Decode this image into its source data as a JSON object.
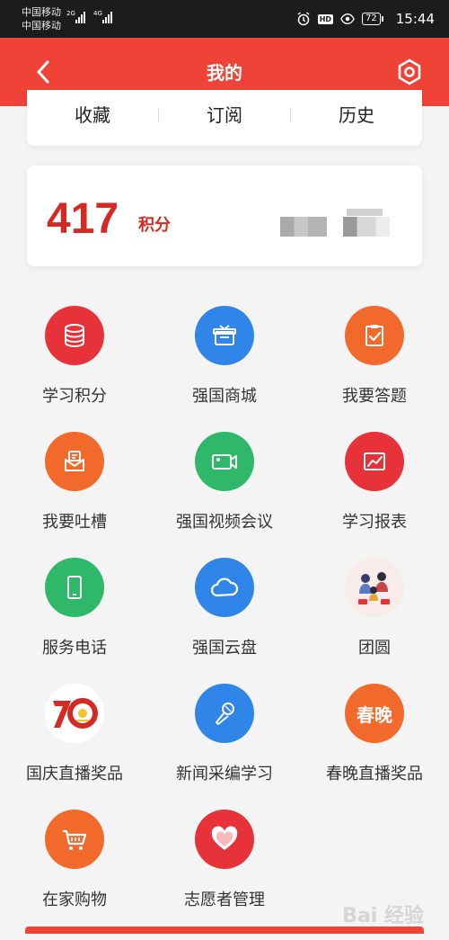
{
  "status_bar": {
    "carrier1": "中国移动",
    "carrier2": "中国移动",
    "net1": "2G",
    "net2": "4G",
    "battery": "72",
    "time": "15:44"
  },
  "header": {
    "title": "我的"
  },
  "quick_links": [
    {
      "label": "收藏"
    },
    {
      "label": "订阅"
    },
    {
      "label": "历史"
    }
  ],
  "points": {
    "value": "417",
    "unit": "积分"
  },
  "grid_items": [
    {
      "label": "学习积分",
      "icon": "database-icon",
      "color": "#e8323a"
    },
    {
      "label": "强国商城",
      "icon": "gift-box-icon",
      "color": "#2f86e8"
    },
    {
      "label": "我要答题",
      "icon": "clipboard-check-icon",
      "color": "#f26a2b"
    },
    {
      "label": "我要吐槽",
      "icon": "mail-chat-icon",
      "color": "#f26a2b"
    },
    {
      "label": "强国视频会议",
      "icon": "video-camera-icon",
      "color": "#2fb86a"
    },
    {
      "label": "学习报表",
      "icon": "trend-chart-icon",
      "color": "#e8323a"
    },
    {
      "label": "服务电话",
      "icon": "phone-icon",
      "color": "#2fb86a"
    },
    {
      "label": "强国云盘",
      "icon": "cloud-icon",
      "color": "#2f86e8"
    },
    {
      "label": "团圆",
      "icon": "family-illustration-icon",
      "color": "#f7ecea"
    },
    {
      "label": "国庆直播奖品",
      "icon": "seventy-anniversary-icon",
      "color": "#ffffff"
    },
    {
      "label": "新闻采编学习",
      "icon": "microphone-icon",
      "color": "#2f86e8"
    },
    {
      "label": "春晚直播奖品",
      "icon": "chunwan-badge-icon",
      "color": "#f26a2b",
      "badge_text": "春晚"
    },
    {
      "label": "在家购物",
      "icon": "shopping-cart-icon",
      "color": "#f26a2b"
    },
    {
      "label": "志愿者管理",
      "icon": "heart-icon",
      "color": "#e8323a"
    }
  ],
  "watermark": "Bai 经验"
}
